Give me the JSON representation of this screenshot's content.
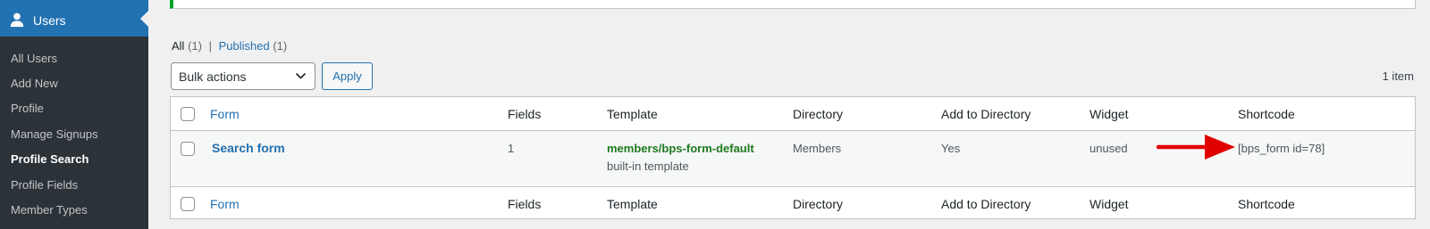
{
  "sidebar": {
    "menu_label": "Users",
    "menu_icon": "user-icon",
    "items": [
      {
        "label": "All Users"
      },
      {
        "label": "Add New"
      },
      {
        "label": "Profile"
      },
      {
        "label": "Manage Signups"
      },
      {
        "label": "Profile Search"
      },
      {
        "label": "Profile Fields"
      },
      {
        "label": "Member Types"
      }
    ],
    "active_item": "Profile Search"
  },
  "views": {
    "all_label": "All",
    "all_count": "(1)",
    "separator": "|",
    "published_label": "Published",
    "published_count": "(1)"
  },
  "bulk": {
    "selected": "Bulk actions",
    "apply_label": "Apply"
  },
  "item_count": "1 item",
  "table": {
    "columns": [
      "Form",
      "Fields",
      "Template",
      "Directory",
      "Add to Directory",
      "Widget",
      "Shortcode"
    ],
    "rows": [
      {
        "form": "Search form",
        "fields": "1",
        "template": "members/bps-form-default",
        "template_note": "built-in template",
        "directory": "Members",
        "add_to_directory": "Yes",
        "widget": "unused",
        "shortcode": "[bps_form id=78]"
      }
    ]
  },
  "colors": {
    "sidebar_bg": "#2c3338",
    "accent": "#2271b1",
    "notice_border": "#00a32a",
    "arrow": "#e00000"
  }
}
